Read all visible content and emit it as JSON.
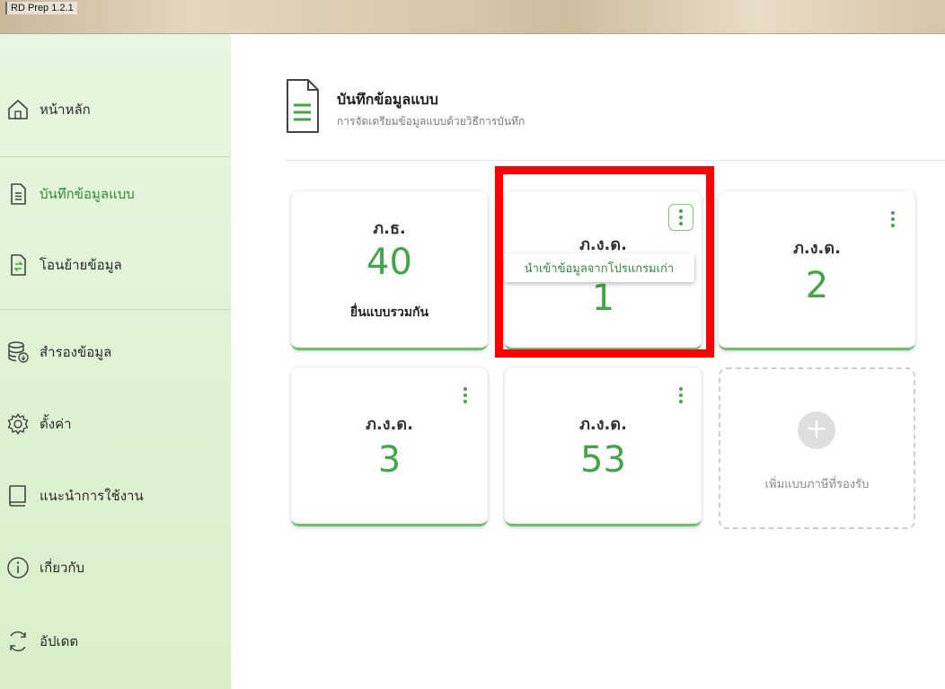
{
  "window": {
    "title": "RD Prep 1.2.1"
  },
  "sidebar": {
    "items": [
      {
        "label": "หน้าหลัก",
        "icon": "home-icon",
        "active": false
      },
      {
        "label": "บันทึกข้อมูลแบบ",
        "icon": "document-list-icon",
        "active": true
      },
      {
        "label": "โอนย้ายข้อมูล",
        "icon": "file-transfer-icon",
        "active": false
      },
      {
        "label": "สำรองข้อมูล",
        "icon": "database-backup-icon",
        "active": false
      },
      {
        "label": "ตั้งค่า",
        "icon": "gear-icon",
        "active": false
      },
      {
        "label": "แนะนำการใช้งาน",
        "icon": "book-icon",
        "active": false
      },
      {
        "label": "เกี่ยวกับ",
        "icon": "info-icon",
        "active": false
      },
      {
        "label": "อัปเดต",
        "icon": "refresh-icon",
        "active": false
      }
    ]
  },
  "header": {
    "title": "บันทึกข้อมูลแบบ",
    "subtitle": "การจัดเตรียมข้อมูลแบบด้วยวิธีการบันทึก"
  },
  "cards": [
    {
      "form": "ภ.ธ.",
      "count": "40",
      "note": "ยื่นแบบรวมกัน"
    },
    {
      "form": "ภ.ง.ด.",
      "count": "1",
      "note": ""
    },
    {
      "form": "ภ.ง.ด.",
      "count": "2",
      "note": ""
    },
    {
      "form": "ภ.ง.ด.",
      "count": "3",
      "note": ""
    },
    {
      "form": "ภ.ง.ด.",
      "count": "53",
      "note": ""
    }
  ],
  "popup_menu": {
    "item": "นำเข้าข้อมูลจากโปรแกรมเก่า"
  },
  "add_card": {
    "label": "เพิ่มแบบภาษีที่รองรับ",
    "plus": "+"
  },
  "colors": {
    "accent": "#43a547",
    "sidebar_bg": "#e2f3d8",
    "highlight": "#ff0000"
  }
}
